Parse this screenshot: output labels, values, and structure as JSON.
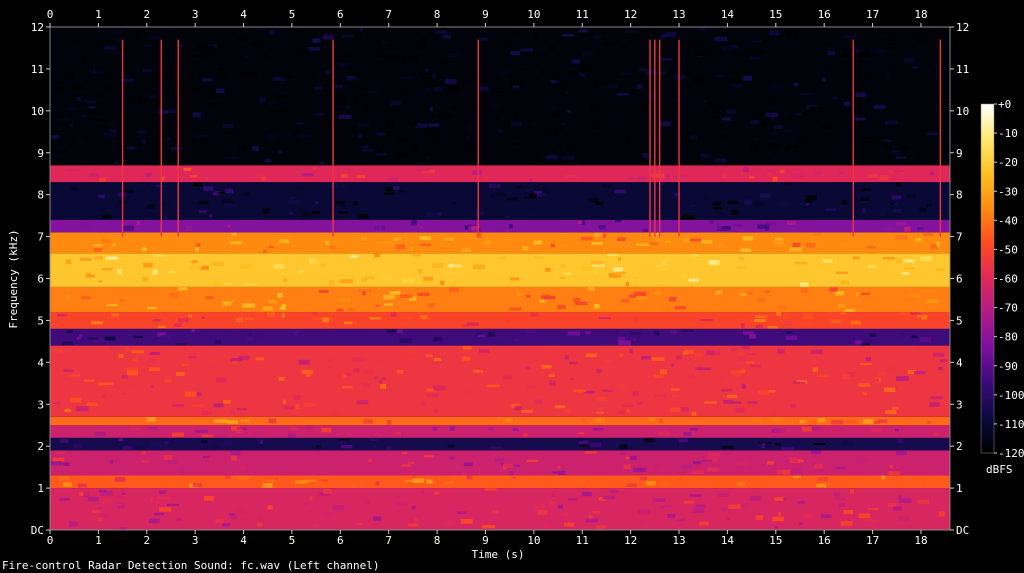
{
  "caption": "Fire-control Radar Detection Sound: fc.wav (Left channel)",
  "chart_data": {
    "type": "heatmap",
    "xlabel": "Time (s)",
    "ylabel": "Frequency (kHz)",
    "xlim": [
      0,
      18.6
    ],
    "ylim": [
      0,
      12
    ],
    "x_ticks": [
      0,
      1,
      2,
      3,
      4,
      5,
      6,
      7,
      8,
      9,
      10,
      11,
      12,
      13,
      14,
      15,
      16,
      17,
      18
    ],
    "y_ticks": [
      "DC",
      "1",
      "2",
      "3",
      "4",
      "5",
      "6",
      "7",
      "8",
      "9",
      "10",
      "11",
      "12"
    ],
    "colorbar": {
      "label": "dBFS",
      "range": [
        -120,
        0
      ],
      "ticks": [
        "+0",
        "-10",
        "-20",
        "-30",
        "-40",
        "-50",
        "-60",
        "-70",
        "-80",
        "-90",
        "-100",
        "-110",
        "-120"
      ],
      "colors": [
        "#000000",
        "#0c0a40",
        "#3a0a78",
        "#7a10a0",
        "#b01a8a",
        "#e02858",
        "#ff4a20",
        "#ff8a10",
        "#ffc020",
        "#ffe870",
        "#ffffff"
      ]
    },
    "bands": [
      {
        "from_khz": 0.0,
        "to_khz": 1.0,
        "level_db": -62
      },
      {
        "from_khz": 1.0,
        "to_khz": 1.3,
        "level_db": -45
      },
      {
        "from_khz": 1.3,
        "to_khz": 1.9,
        "level_db": -65
      },
      {
        "from_khz": 1.9,
        "to_khz": 2.2,
        "level_db": -105
      },
      {
        "from_khz": 2.2,
        "to_khz": 2.5,
        "level_db": -65
      },
      {
        "from_khz": 2.5,
        "to_khz": 2.7,
        "level_db": -42
      },
      {
        "from_khz": 2.7,
        "to_khz": 4.4,
        "level_db": -55
      },
      {
        "from_khz": 4.4,
        "to_khz": 4.8,
        "level_db": -95
      },
      {
        "from_khz": 4.8,
        "to_khz": 5.2,
        "level_db": -50
      },
      {
        "from_khz": 5.2,
        "to_khz": 5.8,
        "level_db": -38
      },
      {
        "from_khz": 5.8,
        "to_khz": 6.6,
        "level_db": -22
      },
      {
        "from_khz": 6.6,
        "to_khz": 7.1,
        "level_db": -36
      },
      {
        "from_khz": 7.1,
        "to_khz": 7.4,
        "level_db": -82
      },
      {
        "from_khz": 7.4,
        "to_khz": 8.3,
        "level_db": -110
      },
      {
        "from_khz": 8.3,
        "to_khz": 8.7,
        "level_db": -60
      },
      {
        "from_khz": 8.7,
        "to_khz": 12.0,
        "level_db": -118
      }
    ],
    "vertical_transients_s": [
      1.5,
      2.3,
      2.65,
      5.85,
      8.85,
      12.4,
      12.5,
      12.6,
      13.0,
      16.6,
      18.4
    ]
  }
}
